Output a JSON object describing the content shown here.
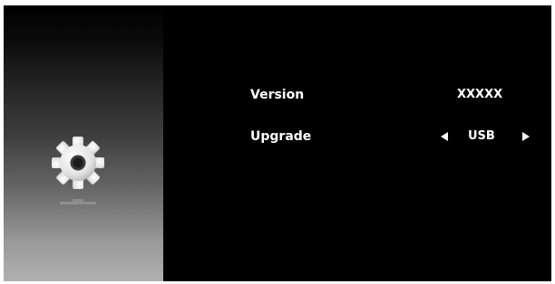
{
  "sidebar": {
    "icon": "gear-icon"
  },
  "settings": {
    "version": {
      "label": "Version",
      "value": "XXXXX"
    },
    "upgrade": {
      "label": "Upgrade",
      "value": "USB",
      "prev_icon": "triangle-left-icon",
      "next_icon": "triangle-right-icon"
    }
  },
  "colors": {
    "background": "#000000",
    "text": "#ffffff",
    "sidebar_gradient_top": "#000000",
    "sidebar_gradient_bottom": "#b0b0b0"
  }
}
